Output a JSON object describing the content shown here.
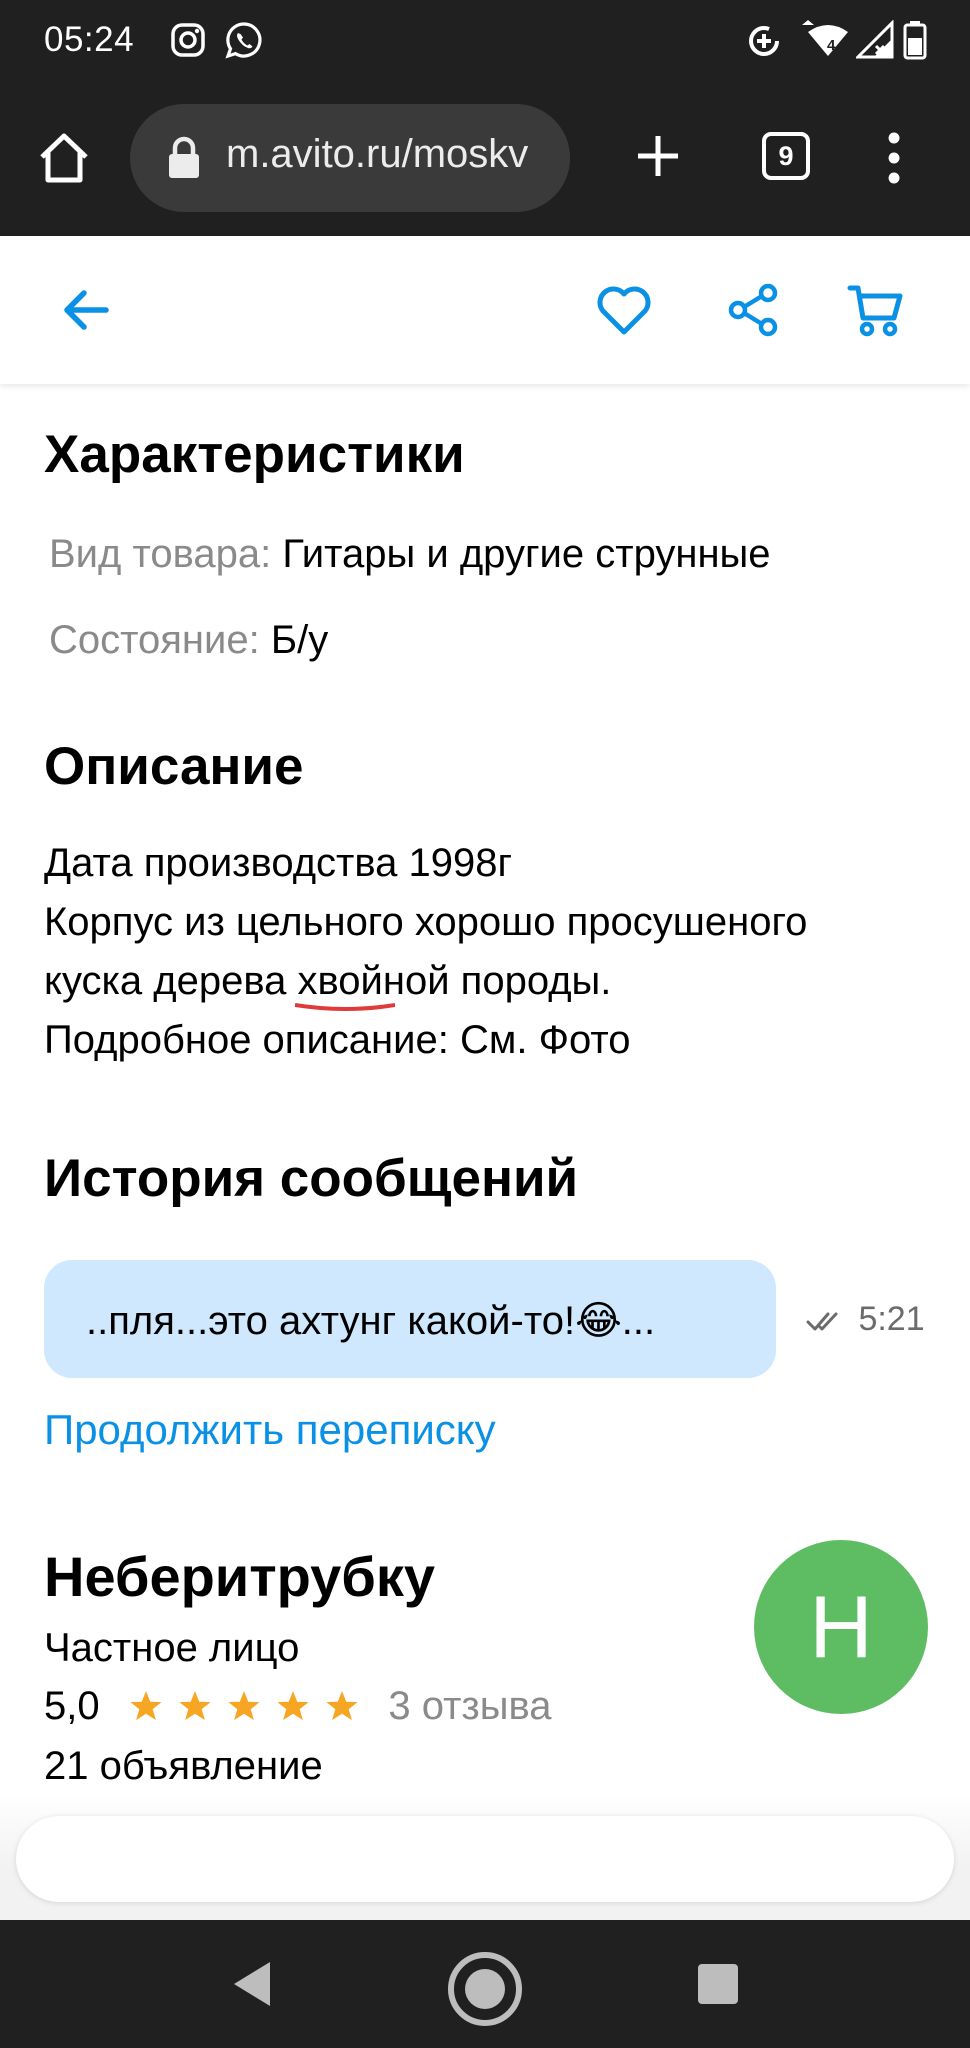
{
  "status_bar": {
    "time": "05:24",
    "icons": [
      "instagram-icon",
      "whatsapp-icon",
      "data-saver-icon",
      "wifi-icon",
      "signal-icon",
      "battery-icon"
    ]
  },
  "browser": {
    "url": "m.avito.ru/moskv",
    "tab_count": "9",
    "icons": [
      "home-icon",
      "lock-icon",
      "plus-icon",
      "tabs-icon",
      "more-vert-icon"
    ]
  },
  "app_header": {
    "icons": [
      "back-arrow-icon",
      "heart-icon",
      "share-icon",
      "cart-icon"
    ],
    "accent_color": "#0a91e5"
  },
  "characteristics": {
    "title": "Характеристики",
    "rows": [
      {
        "key": "Вид товара:",
        "value": "Гитары и другие струнные"
      },
      {
        "key": "Состояние:",
        "value": "Б/у"
      }
    ]
  },
  "description": {
    "title": "Описание",
    "line1": "Дата производства 1998г",
    "line2": "Корпус из цельного хорошо просушеного",
    "line3_before": "куска дерева ",
    "line3_spell": "хвойной",
    "line3_after": " породы.",
    "line4": "Подробное описание: См. Фото"
  },
  "messages": {
    "title": "История сообщений",
    "last_message": "..пля...это ахтунг какой-то!😂...",
    "time": "5:21",
    "bubble_color": "#cfe8fd",
    "continue_label": "Продолжить переписку"
  },
  "seller": {
    "name": "Неберитрубку",
    "type": "Частное лицо",
    "rating": "5,0",
    "stars": 5,
    "reviews": "3 отзыва",
    "ads": "21 объявление",
    "avatar_letter": "Н",
    "avatar_color": "#5ebd63"
  },
  "nav_bar": {
    "icons": [
      "back-triangle-icon",
      "home-circle-icon",
      "recents-square-icon"
    ]
  }
}
